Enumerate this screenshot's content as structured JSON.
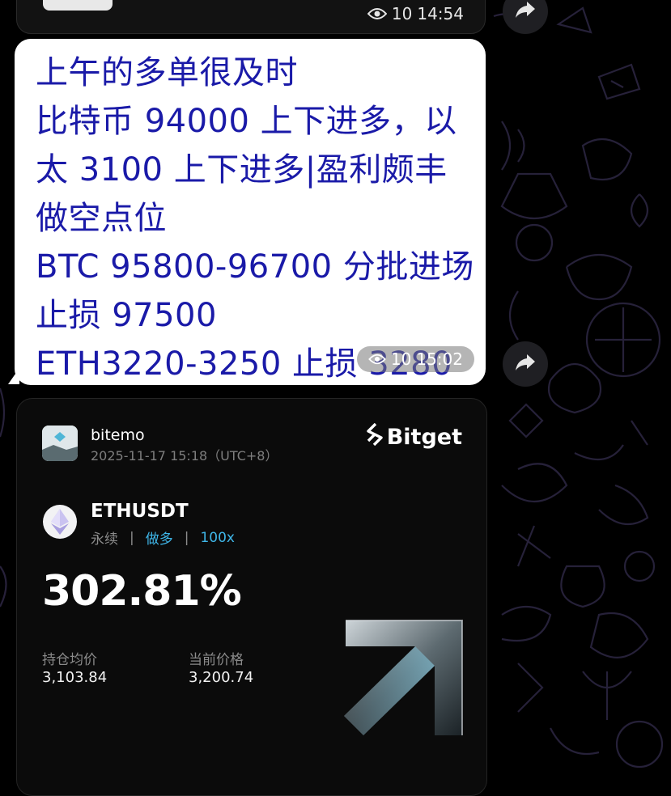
{
  "top_message": {
    "views": "10",
    "time": "14:54"
  },
  "message": {
    "lines": [
      "上午的多单很及时",
      "比特币 94000 上下进多，以",
      "太 3100 上下进多|盈利颇丰",
      "做空点位",
      "BTC 95800-96700 分批进场",
      "止损 97500",
      "ETH3220-3250  止损 3280"
    ],
    "views": "10",
    "time": "15:02"
  },
  "card": {
    "brand": "Bitget",
    "user": "bitemo",
    "timestamp": "2025-11-17 15:18（UTC+8）",
    "pair": "ETHUSDT",
    "contract_type": "永续",
    "separator": "|",
    "direction": "做多",
    "leverage": "100x",
    "pnl_percent": "302.81%",
    "entry_label": "持仓均价",
    "entry_value": "3,103.84",
    "current_label": "当前价格",
    "current_value": "3,200.74"
  },
  "colors": {
    "message_text": "#1a1aa8",
    "accent_blue": "#3fb6e8",
    "card_bg": "#0b0b0b"
  },
  "icons": [
    "eye-icon",
    "forward-icon",
    "ethereum-icon",
    "bitget-logo-icon",
    "avatar"
  ]
}
